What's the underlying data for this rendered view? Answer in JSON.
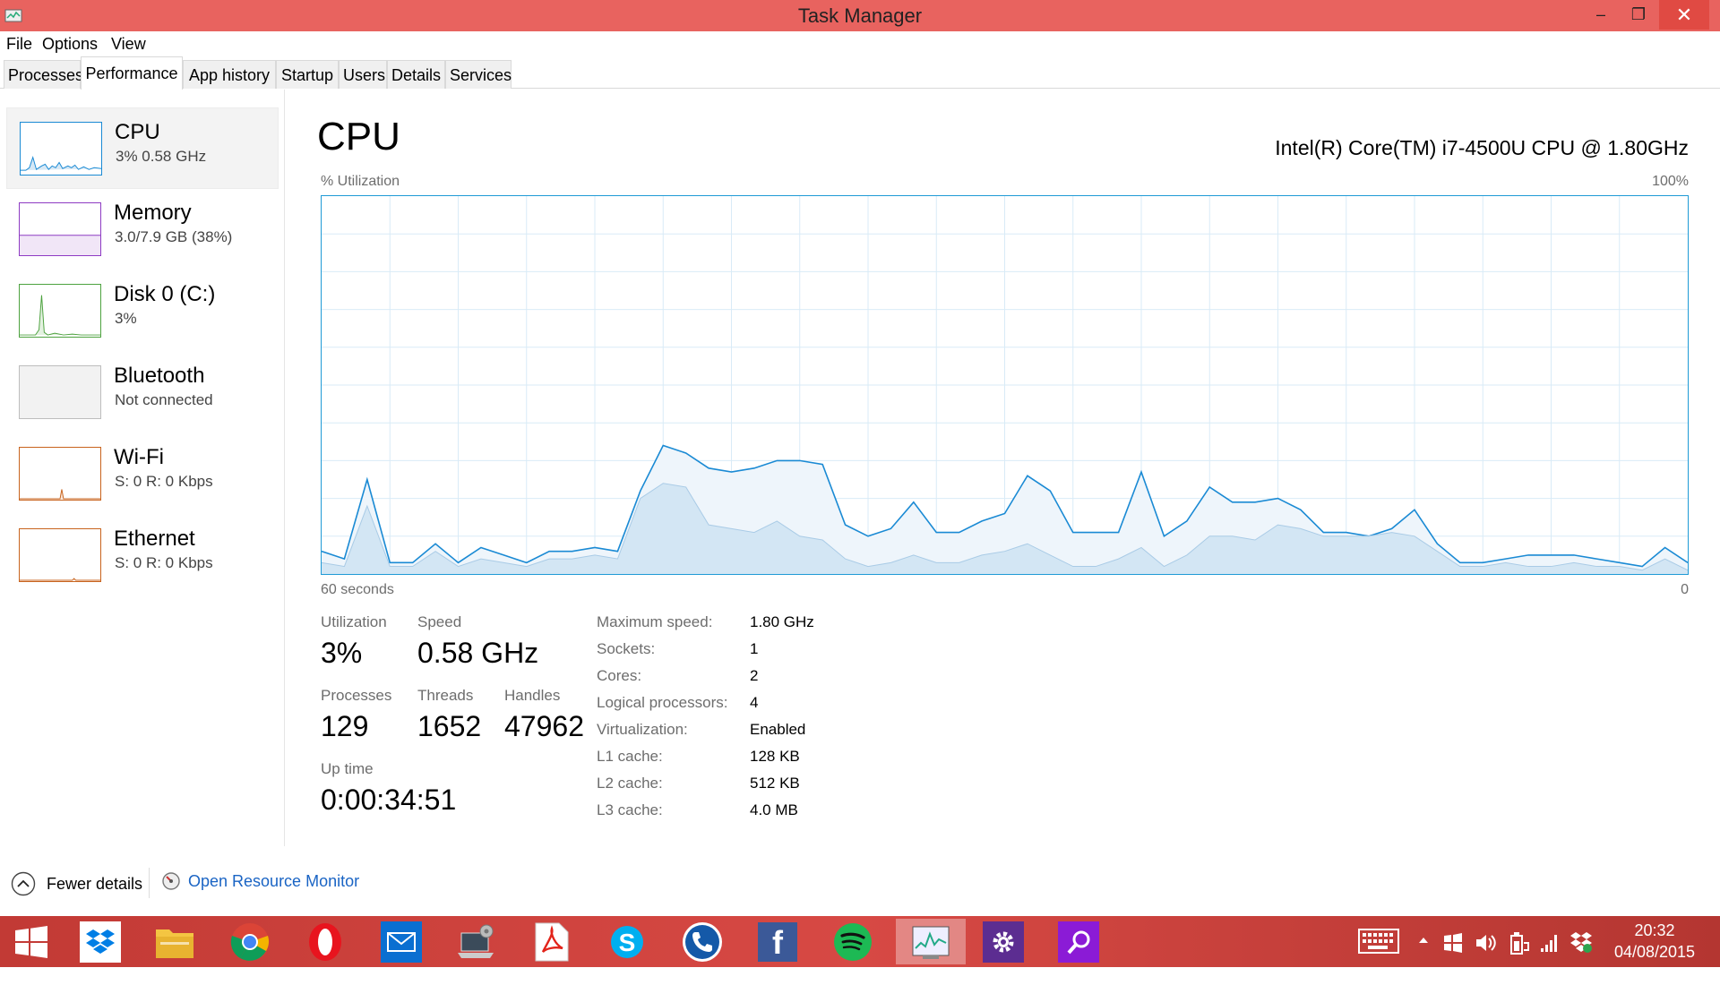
{
  "window": {
    "title": "Task Manager",
    "minimize": "–",
    "maximize": "❐",
    "close": "✕"
  },
  "menu": {
    "file": "File",
    "options": "Options",
    "view": "View"
  },
  "tabs": [
    "Processes",
    "Performance",
    "App history",
    "Startup",
    "Users",
    "Details",
    "Services"
  ],
  "sidebar": [
    {
      "name": "CPU",
      "sub": "3%  0.58 GHz",
      "color": "#1a8ad4"
    },
    {
      "name": "Memory",
      "sub": "3.0/7.9 GB (38%)",
      "color": "#8e3bc3"
    },
    {
      "name": "Disk 0 (C:)",
      "sub": "3%",
      "color": "#4da23f"
    },
    {
      "name": "Bluetooth",
      "sub": "Not connected",
      "color": "#bdbdbd"
    },
    {
      "name": "Wi-Fi",
      "sub": "S: 0  R: 0 Kbps",
      "color": "#c8631d"
    },
    {
      "name": "Ethernet",
      "sub": "S: 0  R: 0 Kbps",
      "color": "#c8631d"
    }
  ],
  "main": {
    "title": "CPU",
    "cpu_name": "Intel(R) Core(TM) i7-4500U CPU @ 1.80GHz",
    "y_label": "% Utilization",
    "y_max_label": "100%",
    "x_left_label": "60 seconds",
    "x_right_label": "0"
  },
  "stats": {
    "utilization_label": "Utilization",
    "utilization": "3%",
    "speed_label": "Speed",
    "speed": "0.58 GHz",
    "processes_label": "Processes",
    "processes": "129",
    "threads_label": "Threads",
    "threads": "1652",
    "handles_label": "Handles",
    "handles": "47962",
    "uptime_label": "Up time",
    "uptime": "0:00:34:51"
  },
  "specs": [
    {
      "k": "Maximum speed:",
      "v": "1.80 GHz"
    },
    {
      "k": "Sockets:",
      "v": "1"
    },
    {
      "k": "Cores:",
      "v": "2"
    },
    {
      "k": "Logical processors:",
      "v": "4"
    },
    {
      "k": "Virtualization:",
      "v": "Enabled"
    },
    {
      "k": "L1 cache:",
      "v": "128 KB"
    },
    {
      "k": "L2 cache:",
      "v": "512 KB"
    },
    {
      "k": "L3 cache:",
      "v": "4.0 MB"
    }
  ],
  "footer": {
    "fewer_details": "Fewer details",
    "open_resource_monitor": "Open Resource Monitor"
  },
  "taskbar": {
    "apps": [
      "start",
      "dropbox",
      "file-explorer",
      "chrome",
      "opera",
      "mail",
      "control-panel",
      "adobe-reader",
      "skype",
      "phone",
      "facebook",
      "spotify",
      "task-manager",
      "settings",
      "search"
    ],
    "clock_time": "20:32",
    "clock_date": "04/08/2015"
  },
  "chart_data": {
    "type": "area",
    "ylim": [
      0,
      100
    ],
    "x": [
      60,
      59,
      58,
      57,
      56,
      55,
      54,
      53,
      52,
      51,
      50,
      49,
      48,
      47,
      46,
      45,
      44,
      43,
      42,
      41,
      40,
      39,
      38,
      37,
      36,
      35,
      34,
      33,
      32,
      31,
      30,
      29,
      28,
      27,
      26,
      25,
      24,
      23,
      22,
      21,
      20,
      19,
      18,
      17,
      16,
      15,
      14,
      13,
      12,
      11,
      10,
      9,
      8,
      7,
      6,
      5,
      4,
      3,
      2,
      1,
      0
    ],
    "series": [
      {
        "values": [
          6,
          4,
          25,
          3,
          3,
          8,
          3,
          7,
          5,
          3,
          6,
          6,
          7,
          6,
          22,
          34,
          32,
          28,
          27,
          28,
          30,
          30,
          29,
          13,
          10,
          12,
          19,
          11,
          11,
          14,
          16,
          26,
          22,
          11,
          11,
          11,
          27,
          10,
          14,
          23,
          19,
          19,
          20,
          17,
          11,
          11,
          10,
          12,
          17,
          8,
          3,
          3,
          4,
          5,
          5,
          5,
          4,
          3,
          2,
          7,
          3
        ]
      },
      {
        "values": [
          3,
          2,
          18,
          2,
          2,
          6,
          2,
          4,
          3,
          2,
          4,
          4,
          5,
          4,
          20,
          24,
          23,
          13,
          12,
          11,
          14,
          10,
          9,
          4,
          2,
          3,
          5,
          3,
          3,
          5,
          6,
          8,
          5,
          2,
          2,
          4,
          7,
          2,
          5,
          10,
          10,
          9,
          13,
          12,
          10,
          10,
          10,
          11,
          10,
          6,
          2,
          2,
          3,
          2,
          2,
          3,
          2,
          2,
          1,
          4,
          1
        ]
      }
    ]
  }
}
